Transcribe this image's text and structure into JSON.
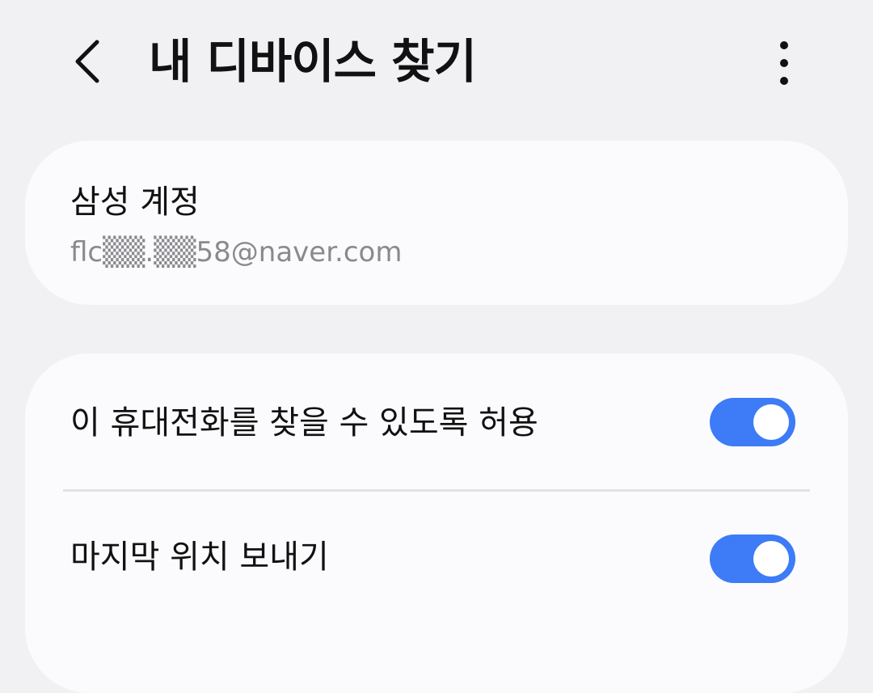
{
  "header": {
    "back_icon": "chevron-left-icon",
    "title": "내 디바이스 찾기",
    "more_icon": "more-vertical-icon"
  },
  "account": {
    "title": "삼성 계정",
    "email": "flc▒▒.▒▒58@naver.com"
  },
  "settings": {
    "allow_find_phone": {
      "label": "이 휴대전화를 찾을 수 있도록 허용",
      "enabled": true
    },
    "send_last_location": {
      "label": "마지막 위치 보내기",
      "enabled": true
    }
  },
  "colors": {
    "background": "#f1f1f3",
    "card": "#fbfbfd",
    "toggle_on": "#3d7bf7",
    "secondary_text": "#8a8a8e"
  }
}
